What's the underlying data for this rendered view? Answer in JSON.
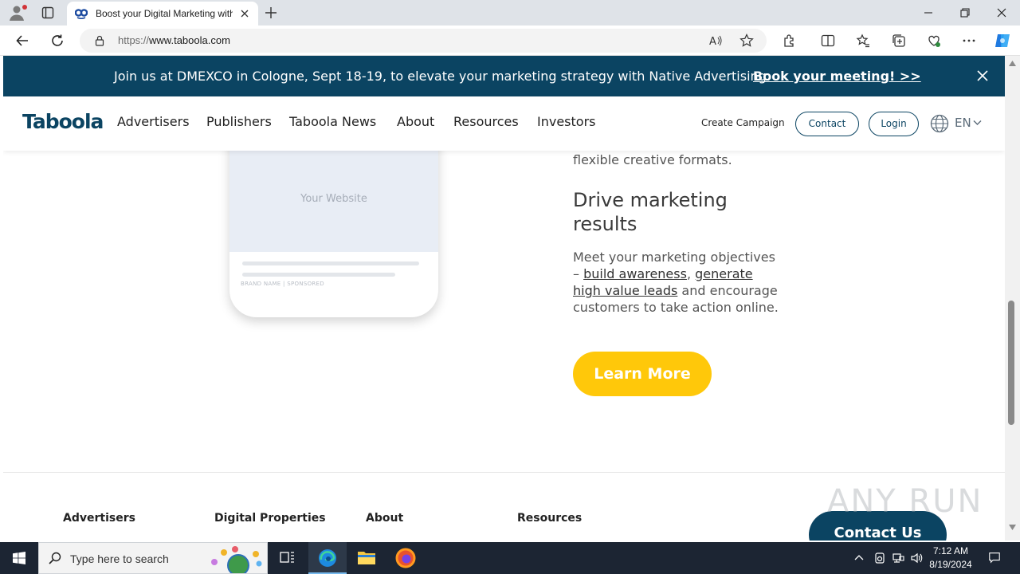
{
  "browser": {
    "tab_title": "Boost your Digital Marketing with",
    "url_protocol": "https://",
    "url_host": "www.taboola.com"
  },
  "banner": {
    "text": "Join us at DMEXCO in Cologne, Sept 18-19, to elevate your marketing strategy with Native Advertising.",
    "link": "Book your meeting! >>"
  },
  "nav": {
    "logo": "Taboola",
    "items": [
      "Advertisers",
      "Publishers",
      "Taboola News",
      "About",
      "Resources",
      "Investors"
    ],
    "create_campaign": "Create Campaign",
    "contact": "Contact",
    "login": "Login",
    "language": "EN"
  },
  "content": {
    "phone_label": "Your Website",
    "phone_brand": "BRAND NAME | SPONSORED",
    "lead_line": "flexible creative formats.",
    "heading": "Drive marketing results",
    "para_pre": "Meet your marketing objectives – ",
    "para_link1": "build awareness",
    "para_mid": ", ",
    "para_link2": "generate high value leads",
    "para_post": " and encourage customers to take action online.",
    "learn_more": "Learn More"
  },
  "footer": {
    "col1": "Advertisers",
    "col2": "Digital Properties",
    "col3": "About",
    "col4": "Resources",
    "contact_us": "Contact Us"
  },
  "watermark": "ANY RUN",
  "taskbar": {
    "search_placeholder": "Type here to search",
    "time": "7:12 AM",
    "date": "8/19/2024"
  },
  "colors": {
    "brand_navy": "#0b4462",
    "cta_yellow": "#ffc80a"
  }
}
